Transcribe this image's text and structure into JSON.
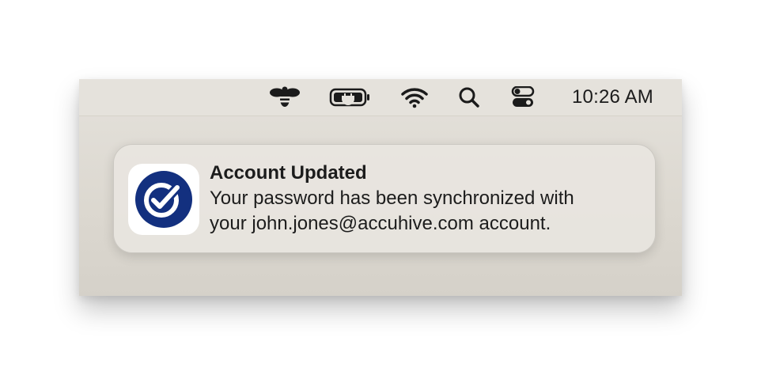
{
  "menubar": {
    "icons": [
      "bee-icon",
      "battery-charging-icon",
      "wifi-icon",
      "search-icon",
      "control-center-icon"
    ],
    "clock": "10:26 AM"
  },
  "notification": {
    "app_icon": "checkmark-circle-icon",
    "title": "Account Updated",
    "body_line1": "Your password has been synchronized with",
    "body_line2": "your john.jones@accuhive.com account."
  },
  "colors": {
    "brand": "#13307f",
    "menubar": "#e5e2dc",
    "text": "#1c1c1c"
  }
}
